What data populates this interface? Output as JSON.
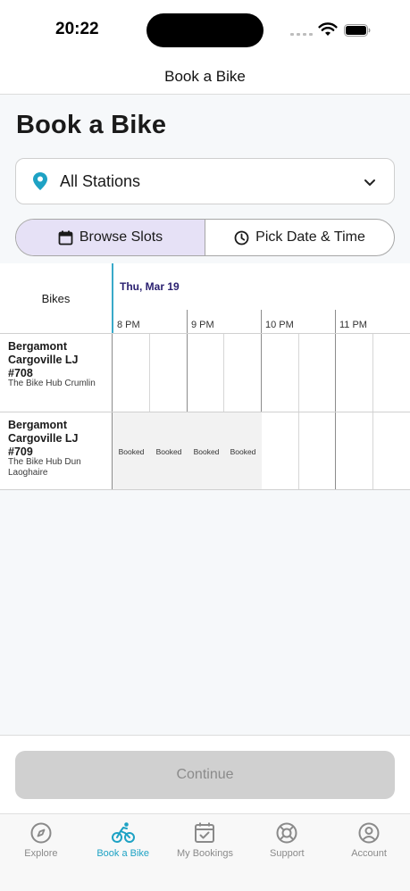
{
  "status": {
    "time": "20:22"
  },
  "nav": {
    "title": "Book a Bike"
  },
  "page": {
    "title": "Book a Bike"
  },
  "station_select": {
    "value": "All Stations",
    "icon": "location-pin-icon"
  },
  "view_toggle": {
    "browse_label": "Browse Slots",
    "pick_label": "Pick Date & Time",
    "active": "browse"
  },
  "schedule": {
    "bikes_header": "Bikes",
    "date": "Thu, Mar 19",
    "hours": [
      "8 PM",
      "9 PM",
      "10 PM",
      "11 PM"
    ],
    "rows": [
      {
        "name": "Bergamont Cargoville LJ #708",
        "station": "The Bike Hub Crumlin",
        "slots": [
          "",
          "",
          "",
          "",
          "",
          "",
          "",
          ""
        ]
      },
      {
        "name": "Bergamont Cargoville LJ #709",
        "station": "The Bike Hub Dun Laoghaire",
        "slots": [
          "Booked",
          "Booked",
          "Booked",
          "Booked",
          "",
          "",
          "",
          ""
        ]
      }
    ]
  },
  "continue_label": "Continue",
  "tabs": [
    {
      "label": "Explore",
      "icon": "compass-icon"
    },
    {
      "label": "Book a Bike",
      "icon": "bike-icon",
      "active": true
    },
    {
      "label": "My Bookings",
      "icon": "calendar-check-icon"
    },
    {
      "label": "Support",
      "icon": "lifebuoy-icon"
    },
    {
      "label": "Account",
      "icon": "user-circle-icon"
    }
  ],
  "colors": {
    "accent": "#1ea2c4",
    "segment_active": "#e6e1f6",
    "date_text": "#2a2070"
  }
}
